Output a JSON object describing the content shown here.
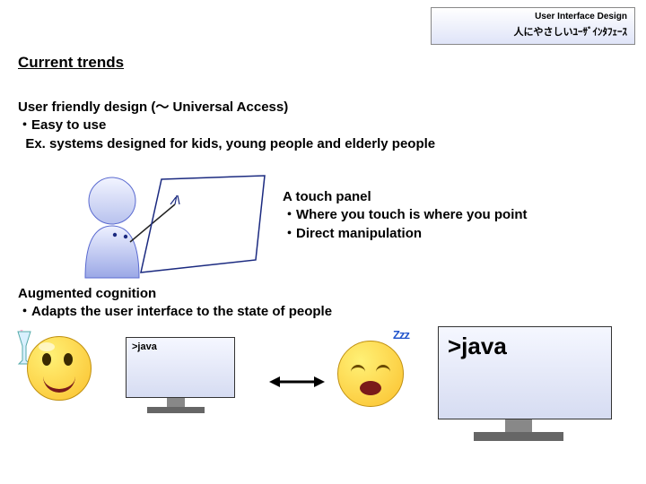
{
  "header": {
    "title": "User Interface Design",
    "subtitle": "人にやさしいﾕｰｻﾞｲﾝﾀﾌｪｰｽ"
  },
  "section_title": "Current trends",
  "user_friendly": {
    "line1": "User friendly design (～ Universal Access)",
    "line2": "・Easy to use",
    "line3": "  Ex. systems designed for kids, young people and elderly people"
  },
  "touch_panel": {
    "line1": "A touch panel",
    "line2": "・Where you touch is where you point",
    "line3": "・Direct manipulation"
  },
  "augmented": {
    "line1": "Augmented cognition",
    "line2": "・Adapts the user interface to the state of people"
  },
  "monitor_small_text": ">java",
  "monitor_large_text": ">java",
  "zzz_text": "Zzz"
}
